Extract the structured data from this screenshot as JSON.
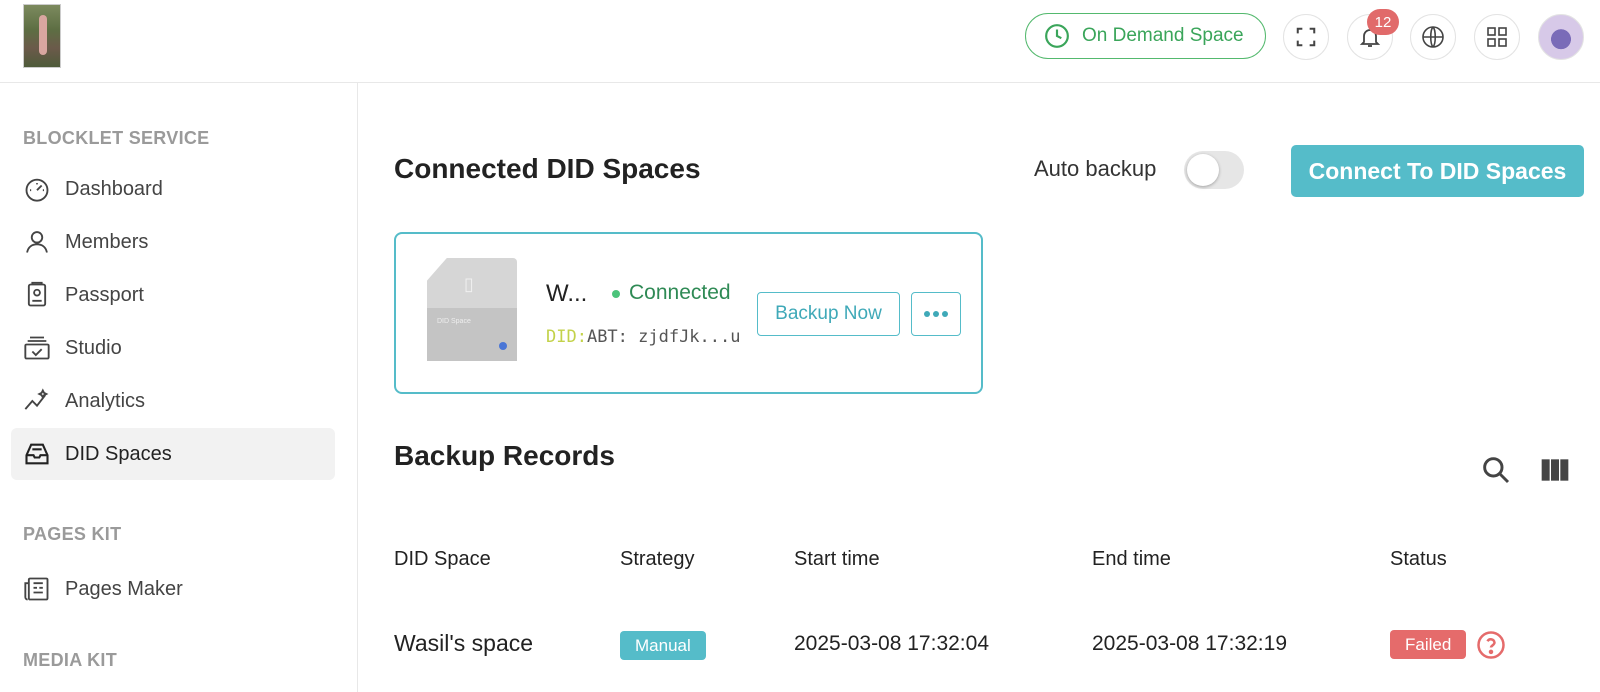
{
  "header": {
    "on_demand_label": "On Demand Space",
    "notification_count": "12"
  },
  "sidebar": {
    "sections": [
      {
        "title": "BLOCKLET SERVICE"
      },
      {
        "title": "PAGES KIT"
      },
      {
        "title": "MEDIA KIT"
      }
    ],
    "items": [
      {
        "label": "Dashboard",
        "icon": "dashboard-icon"
      },
      {
        "label": "Members",
        "icon": "user-icon"
      },
      {
        "label": "Passport",
        "icon": "passport-icon"
      },
      {
        "label": "Studio",
        "icon": "studio-icon"
      },
      {
        "label": "Analytics",
        "icon": "analytics-icon"
      },
      {
        "label": "DID Spaces",
        "icon": "did-spaces-icon",
        "active": true
      },
      {
        "label": "Pages Maker",
        "icon": "pages-icon"
      }
    ]
  },
  "main": {
    "connected_title": "Connected DID Spaces",
    "auto_backup_label": "Auto backup",
    "auto_backup_on": false,
    "connect_button": "Connect To DID Spaces",
    "space": {
      "thumb_title": "DID Space",
      "name": "W...",
      "status": "Connected",
      "did_prefix": "DID:",
      "did_value": "ABT: zjdfJk...uS",
      "backup_button": "Backup Now"
    },
    "records_title": "Backup Records",
    "columns": [
      "DID Space",
      "Strategy",
      "Start time",
      "End time",
      "Status"
    ],
    "rows": [
      {
        "space": "Wasil's space",
        "strategy": "Manual",
        "start": "2025-03-08 17:32:04",
        "end": "2025-03-08 17:32:19",
        "status": "Failed"
      }
    ]
  },
  "colors": {
    "accent": "#55bcc9",
    "success": "#4cc47b",
    "danger": "#e56b6b"
  }
}
